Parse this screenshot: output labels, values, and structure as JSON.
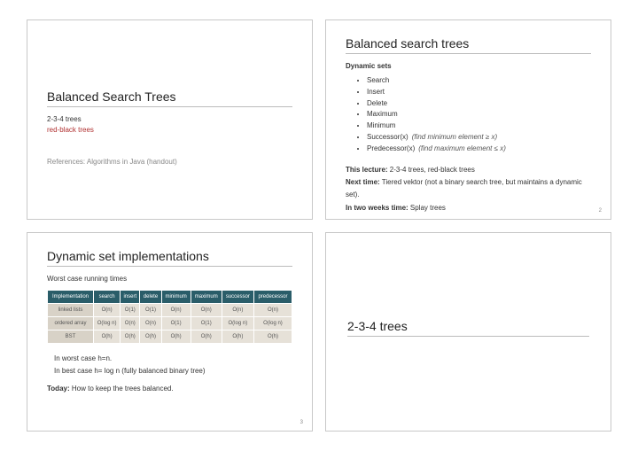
{
  "slide1": {
    "title": "Balanced Search Trees",
    "line1": "2-3-4 trees",
    "line2": "red-black trees",
    "refs": "References: Algorithms in Java (handout)"
  },
  "slide2": {
    "title": "Balanced search trees",
    "heading": "Dynamic sets",
    "bullets": {
      "b0": "Search",
      "b1": "Insert",
      "b2": "Delete",
      "b3": "Maximum",
      "b4": "Minimum",
      "b5": "Successor(x)",
      "b5_hint": "(find minimum element ≥ x)",
      "b6": "Predecessor(x)",
      "b6_hint": "(find maximum element ≤ x)"
    },
    "lecture_label": "This lecture:",
    "lecture_text": " 2-3-4 trees, red-black trees",
    "next_label": "Next time:",
    "next_text": " Tiered vektor (not a binary search tree, but maintains a dynamic set).",
    "two_label": "In two weeks time:",
    "two_text": " Splay trees",
    "page": "2"
  },
  "slide3": {
    "title": "Dynamic set implementations",
    "subtitle": "Worst case running times",
    "headers": {
      "h0": "Implementation",
      "h1": "search",
      "h2": "insert",
      "h3": "delete",
      "h4": "minimum",
      "h5": "maximum",
      "h6": "successor",
      "h7": "predecessor"
    },
    "rows": {
      "r0": {
        "label": "linked lists",
        "c1": "O(n)",
        "c2": "O(1)",
        "c3": "O(1)",
        "c4": "O(n)",
        "c5": "O(n)",
        "c6": "O(n)",
        "c7": "O(n)"
      },
      "r1": {
        "label": "ordered array",
        "c1": "O(log n)",
        "c2": "O(n)",
        "c3": "O(n)",
        "c4": "O(1)",
        "c5": "O(1)",
        "c6": "O(log n)",
        "c7": "O(log n)"
      },
      "r2": {
        "label": "BST",
        "c1": "O(h)",
        "c2": "O(h)",
        "c3": "O(h)",
        "c4": "O(h)",
        "c5": "O(h)",
        "c6": "O(h)",
        "c7": "O(h)"
      }
    },
    "note1": "In worst case h=n.",
    "note2": "In best case h= log n (fully balanced binary tree)",
    "today_label": "Today:",
    "today_text": " How to keep the trees balanced.",
    "page": "3"
  },
  "slide4": {
    "title": "2-3-4 trees"
  }
}
